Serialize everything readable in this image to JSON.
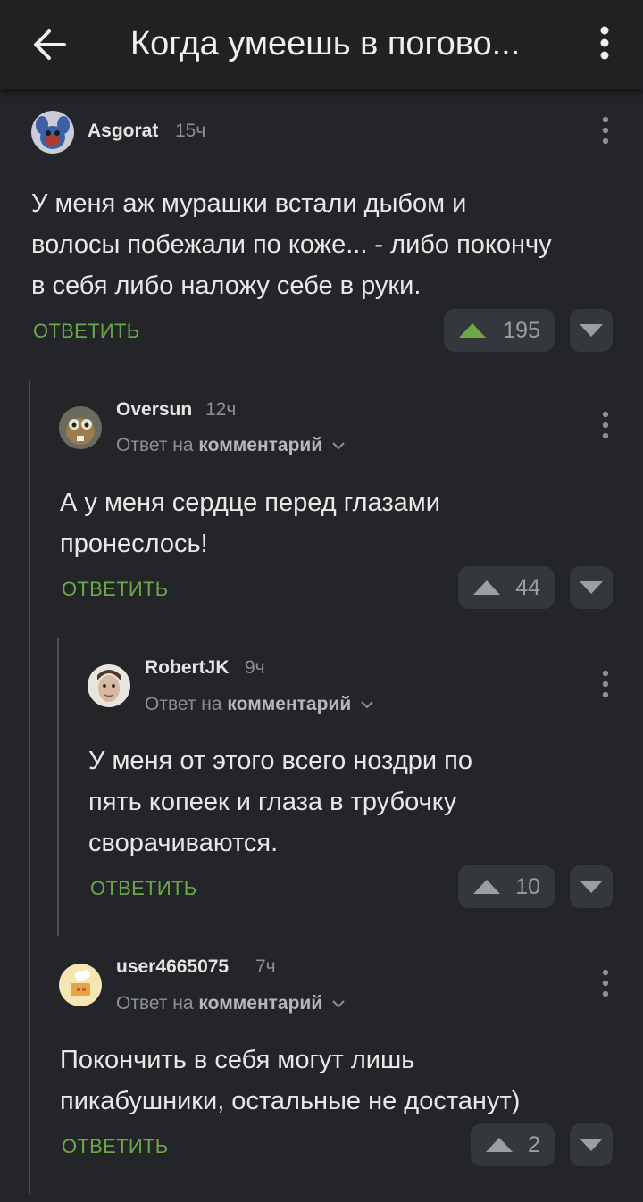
{
  "header": {
    "title": "Когда умеешь в погово..."
  },
  "colors": {
    "accent_green": "#6aa84a",
    "background": "#232528"
  },
  "comments": [
    {
      "username": "Asgorat",
      "time": "15ч",
      "reply_prefix": "",
      "reply_target": "",
      "lines": [
        "У меня аж мурашки встали дыбом и",
        "волосы побежали по коже... - либо покончу",
        "в себя либо наложу себе в руки."
      ],
      "answer_label": "ОТВЕТИТЬ",
      "votes": "195"
    },
    {
      "username": "Oversun",
      "time": "12ч",
      "reply_prefix": "Ответ на",
      "reply_target": "комментарий",
      "lines": [
        "А у меня сердце перед глазами",
        "пронеслось!"
      ],
      "answer_label": "ОТВЕТИТЬ",
      "votes": "44"
    },
    {
      "username": "RobertJK",
      "time": "9ч",
      "reply_prefix": "Ответ на",
      "reply_target": "комментарий",
      "lines": [
        "У меня от этого всего ноздри по",
        "пять копеек и глаза в трубочку",
        "сворачиваются."
      ],
      "answer_label": "ОТВЕТИТЬ",
      "votes": "10"
    },
    {
      "username": "user4665075",
      "time": "7ч",
      "reply_prefix": "Ответ на",
      "reply_target": "комментарий",
      "lines": [
        "Покончить в себя могут лишь",
        "пикабушники, остальные не достанут)"
      ],
      "answer_label": "ОТВЕТИТЬ",
      "votes": "2"
    }
  ]
}
